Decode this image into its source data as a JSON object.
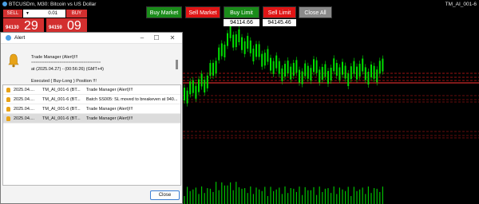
{
  "chart": {
    "title": "BTCUSDm, M30:  Bitcoin vs US Dollar",
    "ea_name": "TM_AI_001-6",
    "colors": {
      "background": "#000000",
      "candle": "#00e000",
      "level": "#d01818",
      "volume": "#00c000"
    }
  },
  "one_click": {
    "sell_label": "SELL",
    "buy_label": "BUY",
    "lot": "0.01",
    "bid_small": "94130",
    "bid_big": "29",
    "ask_small": "94159",
    "ask_big": "09"
  },
  "trade_buttons": {
    "buy_market": "Buy Market",
    "sell_market": "Sell Market",
    "buy_limit": "Buy Limit",
    "sell_limit": "Sell Limit",
    "close_all": "Close All",
    "buy_limit_price": "94114.66",
    "sell_limit_price": "94145.46"
  },
  "alert": {
    "title": "Alert",
    "message_line1": "Trade Manager (Alert)!!!",
    "separator": "================================",
    "message_line2": "at (2025.04.27) - (00:56:26) (GMT+4)",
    "message_line3": "Executed ( Buy-Long ) Position !!!",
    "rows": [
      {
        "date": "2025.04....",
        "name": "TM_AI_001-6 (BT...",
        "message": "Trade Manager (Alert)!!!",
        "selected": false
      },
      {
        "date": "2025.04....",
        "name": "TM_AI_001-6 (BT...",
        "message": "Batch SS005: SL moved to breakeven at 940...",
        "selected": false
      },
      {
        "date": "2025.04....",
        "name": "TM_AI_001-6 (BT...",
        "message": "Trade Manager (Alert)!!!",
        "selected": false
      },
      {
        "date": "2025.04....",
        "name": "TM_AI_001-6 (BT...",
        "message": "Trade Manager (Alert)!!!",
        "selected": true
      }
    ],
    "close_label": "Close"
  }
}
